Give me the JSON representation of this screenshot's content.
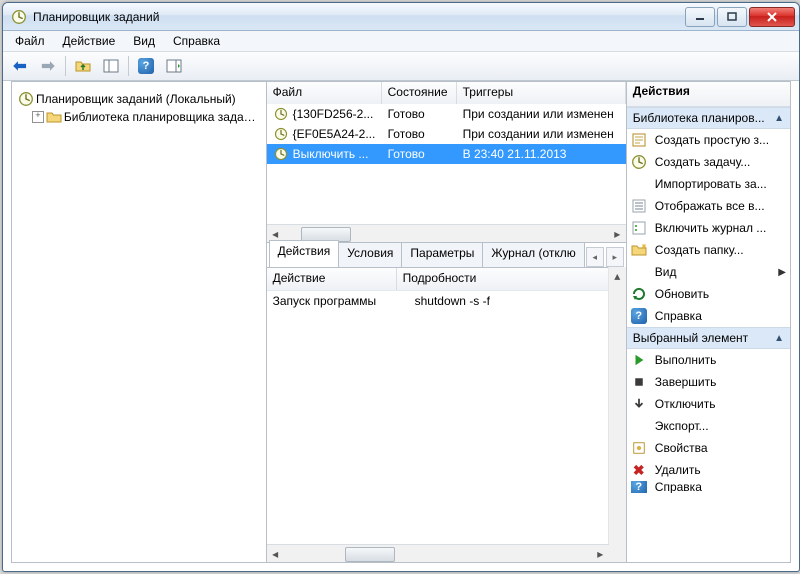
{
  "window": {
    "title": "Планировщик заданий"
  },
  "menu": {
    "file": "Файл",
    "action": "Действие",
    "view": "Вид",
    "help": "Справка"
  },
  "tree": {
    "root": "Планировщик заданий (Локальный)",
    "lib": "Библиотека планировщика заданий"
  },
  "task_columns": {
    "file": "Файл",
    "state": "Состояние",
    "triggers": "Триггеры"
  },
  "tasks": [
    {
      "name": "{130FD256-2...",
      "state": "Готово",
      "trigger": "При создании или изменен"
    },
    {
      "name": "{EF0E5A24-2...",
      "state": "Готово",
      "trigger": "При создании или изменен"
    },
    {
      "name": "Выключить ...",
      "state": "Готово",
      "trigger": "В 23:40 21.11.2013",
      "selected": true
    }
  ],
  "tabs": {
    "actions": "Действия",
    "conditions": "Условия",
    "settings": "Параметры",
    "history": "Журнал (отклю"
  },
  "action_columns": {
    "action": "Действие",
    "details": "Подробности"
  },
  "action_rows": [
    {
      "action": "Запуск программы",
      "details": "shutdown -s -f"
    }
  ],
  "actions_panel": {
    "title": "Действия",
    "group_lib": "Библиотека планиров...",
    "items_lib": {
      "create_basic": "Создать простую з...",
      "create_task": "Создать задачу...",
      "import": "Импортировать за...",
      "show_all": "Отображать все в...",
      "enable_hist": "Включить журнал ...",
      "new_folder": "Создать папку...",
      "view": "Вид",
      "refresh": "Обновить",
      "help": "Справка"
    },
    "group_sel": "Выбранный элемент",
    "items_sel": {
      "run": "Выполнить",
      "end": "Завершить",
      "disable": "Отключить",
      "export": "Экспорт...",
      "props": "Свойства",
      "delete": "Удалить",
      "help2": "Справка"
    }
  }
}
